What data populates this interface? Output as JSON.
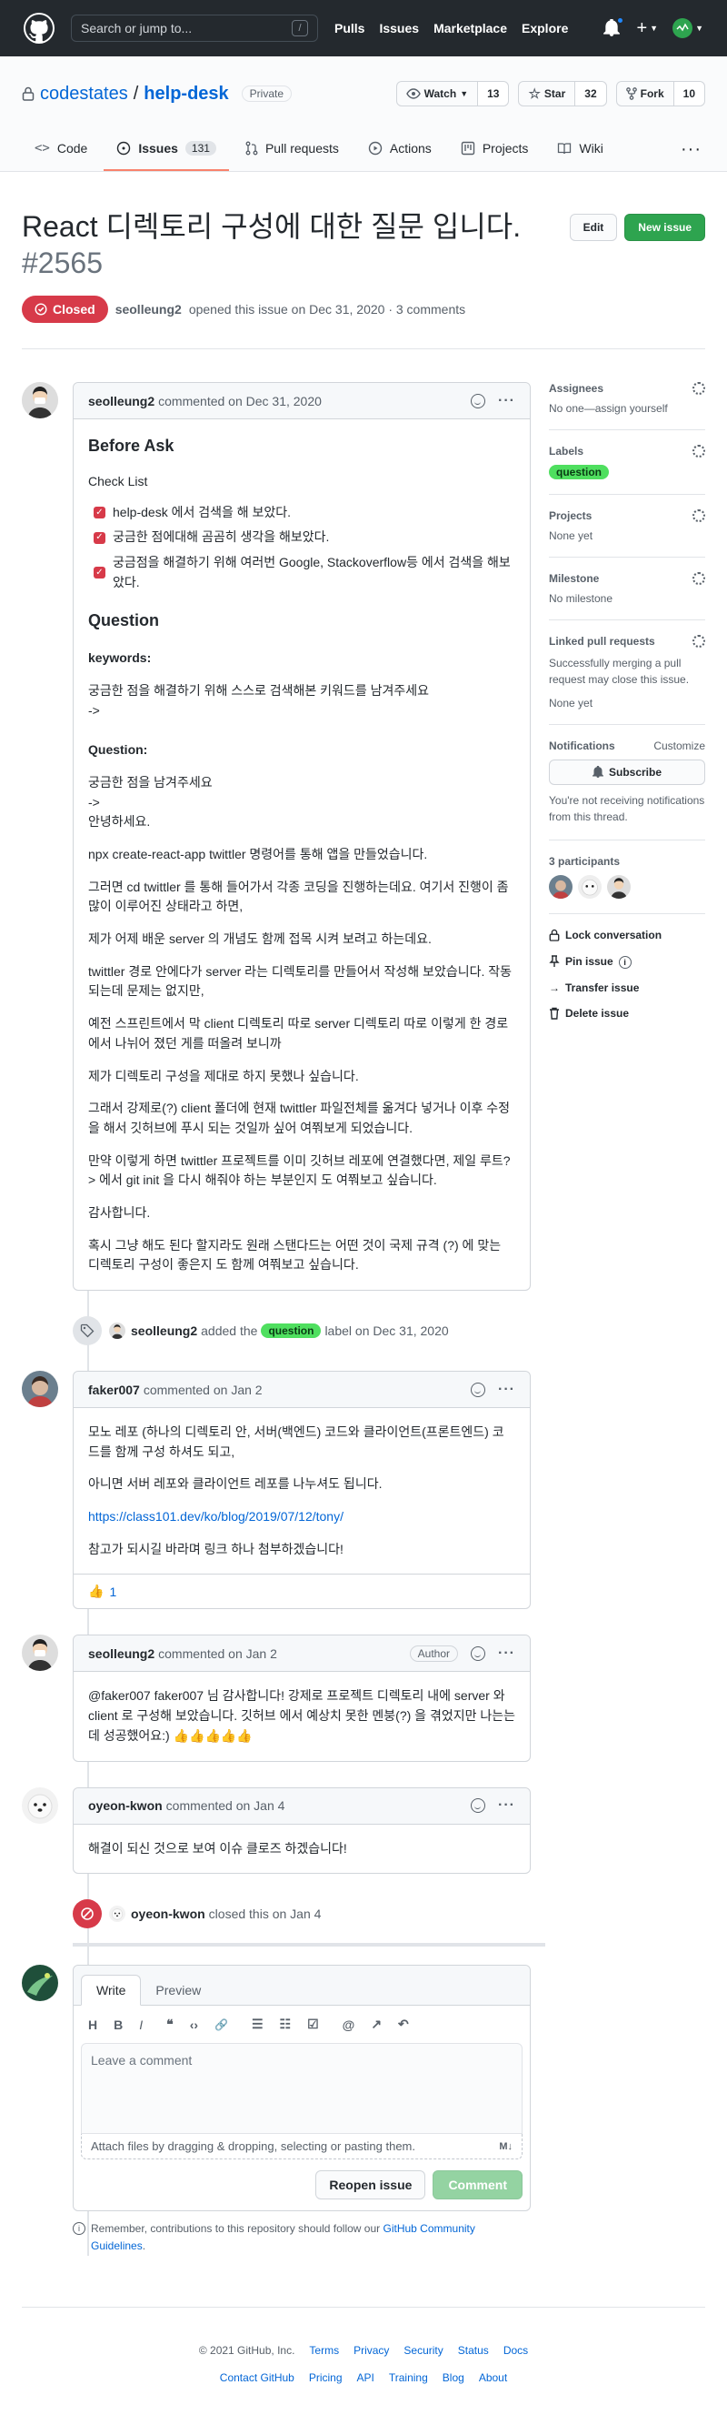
{
  "header": {
    "search_placeholder": "Search or jump to...",
    "search_key": "/",
    "nav": [
      "Pulls",
      "Issues",
      "Marketplace",
      "Explore"
    ],
    "plus": "+"
  },
  "repo": {
    "owner": "codestates",
    "separator": "/",
    "name": "help-desk",
    "visibility": "Private",
    "watch": {
      "label": "Watch",
      "count": "13"
    },
    "star": {
      "label": "Star",
      "count": "32"
    },
    "fork": {
      "label": "Fork",
      "count": "10"
    },
    "tabs": [
      {
        "label": "Code"
      },
      {
        "label": "Issues",
        "count": "131"
      },
      {
        "label": "Pull requests"
      },
      {
        "label": "Actions"
      },
      {
        "label": "Projects"
      },
      {
        "label": "Wiki"
      }
    ],
    "more": "···"
  },
  "issue": {
    "title": "React 디렉토리 구성에 대한 질문 입니다.",
    "number": "#2565",
    "edit": "Edit",
    "new_issue": "New issue",
    "state": "Closed",
    "author": "seolleung2",
    "opened_text": "opened this issue on Dec 31, 2020 · 3 comments"
  },
  "comments": {
    "c1": {
      "author": "seolleung2",
      "meta": "commented on Dec 31, 2020",
      "dots": "···",
      "h_before": "Before Ask",
      "h_check": "Check List",
      "checks": [
        "help-desk 에서 검색을 해 보았다.",
        "궁금한 점에대해 곰곰히 생각을 해보았다.",
        "궁금점을 해결하기 위해 여러번 Google, Stackoverflow등 에서 검색을 해보았다."
      ],
      "h_question": "Question",
      "keywords_label": "keywords:",
      "keywords_text": "궁금한 점을 해결하기 위해 스스로 검색해본 키워드를 남겨주세요",
      "arrow1": "->",
      "question_label": "Question:",
      "q_text": "궁금한 점을 남겨주세요",
      "arrow2": "->",
      "hello": "안녕하세요.",
      "p1": "npx create-react-app twittler 명령어를 통해 앱을 만들었습니다.",
      "p2": "그러면 cd twittler 를 통해 들어가서 각종 코딩을 진행하는데요. 여기서 진행이 좀 많이 이루어진 상태라고 하면,",
      "p3": "제가 어제 배운 server 의 개념도 함께 접목 시켜 보려고 하는데요.",
      "p4": "twittler 경로 안에다가 server 라는 디렉토리를 만들어서 작성해 보았습니다. 작동 되는데 문제는 없지만,",
      "p5": "예전 스프린트에서 막 client 디렉토리 따로 server 디렉토리 따로 이렇게 한 경로에서 나뉘어 졌던 게를 떠올려 보니까",
      "p6": "제가 디렉토리 구성을 제대로 하지 못했나 싶습니다.",
      "p7": "그래서 강제로(?) client 폴더에 현재 twittler 파일전체를 옮겨다 넣거나 이후 수정을 해서 깃허브에 푸시 되는 것일까 싶어 여쭤보게 되었습니다.",
      "p8": "만약 이렇게 하면 twittler 프로젝트를 이미 깃허브 레포에 연결했다면, 제일 루트?> 에서 git init 을 다시 해줘야 하는 부분인지 도 여쭤보고 싶습니다.",
      "p9": "감사합니다.",
      "p10": "혹시 그냥 해도 된다 할지라도 원래 스탠다드는 어떤 것이 국제 규격 (?) 에 맞는 디렉토리 구성이 좋은지 도 함께 여쭤보고 싶습니다."
    },
    "event1": {
      "actor": "seolleung2",
      "before": "added the",
      "label": "question",
      "after": "label on Dec 31, 2020"
    },
    "c2": {
      "author": "faker007",
      "meta": "commented on Jan 2",
      "dots": "···",
      "p1": "모노 레포 (하나의 디렉토리 안, 서버(백엔드) 코드와 클라이언트(프론트엔드) 코드를 함께 구성 하셔도 되고,",
      "p2": "아니면 서버 레포와 클라이언트 레포를 나누셔도 됩니다.",
      "link": "https://class101.dev/ko/blog/2019/07/12/tony/",
      "p3": "참고가 되시길 바라며 링크 하나 첨부하겠습니다!",
      "reaction": "👍",
      "reaction_count": "1"
    },
    "c3": {
      "author": "seolleung2",
      "meta": "commented on Jan 2",
      "badge": "Author",
      "dots": "···",
      "text": "@faker007 faker007 님 감사합니다! 강제로 프로젝트 디렉토리 내에 server 와 client 로 구성해 보았습니다. 깃허브 에서 예상치 못한 멘붕(?) 을 겪었지만 나는는데 성공했어요:) 👍👍👍👍👍"
    },
    "c4": {
      "author": "oyeon-kwon",
      "meta": "commented on Jan 4",
      "dots": "···",
      "text": "해결이 되신 것으로 보여 이슈 클로즈 하겠습니다!"
    },
    "event2": {
      "actor": "oyeon-kwon",
      "text": "closed this on Jan 4"
    }
  },
  "editor": {
    "tab_write": "Write",
    "tab_preview": "Preview",
    "toolbar": [
      "H",
      "B",
      "I",
      "❝",
      "‹›",
      "🔗",
      "☰",
      "☷",
      "☑",
      "@",
      "↗",
      "↶"
    ],
    "placeholder": "Leave a comment",
    "attach": "Attach files by dragging & dropping, selecting or pasting them.",
    "md": "M↓",
    "reopen": "Reopen issue",
    "comment": "Comment",
    "remind_text": "Remember, contributions to this repository should follow our",
    "remind_link": "GitHub Community Guidelines",
    "remind_end": "."
  },
  "sidebar": {
    "assignees": {
      "title": "Assignees",
      "value": "No one—assign yourself"
    },
    "labels": {
      "title": "Labels",
      "value": "question"
    },
    "projects": {
      "title": "Projects",
      "value": "None yet"
    },
    "milestone": {
      "title": "Milestone",
      "value": "No milestone"
    },
    "linked": {
      "title": "Linked pull requests",
      "desc": "Successfully merging a pull request may close this issue.",
      "value": "None yet"
    },
    "notifications": {
      "title": "Notifications",
      "customize": "Customize",
      "subscribe": "Subscribe",
      "desc": "You're not receiving notifications from this thread."
    },
    "participants": {
      "title": "3 participants"
    },
    "actions": [
      "Lock conversation",
      "Pin issue",
      "Transfer issue",
      "Delete issue"
    ]
  },
  "footer": {
    "copyright": "© 2021 GitHub, Inc.",
    "row1": [
      "Terms",
      "Privacy",
      "Security",
      "Status",
      "Docs"
    ],
    "row2": [
      "Contact GitHub",
      "Pricing",
      "API",
      "Training",
      "Blog",
      "About"
    ]
  },
  "colors": {
    "header": "#24292e",
    "closed": "#d73a49",
    "green": "#2ea44f",
    "label": "#4fdf5f",
    "link": "#0366d6"
  }
}
